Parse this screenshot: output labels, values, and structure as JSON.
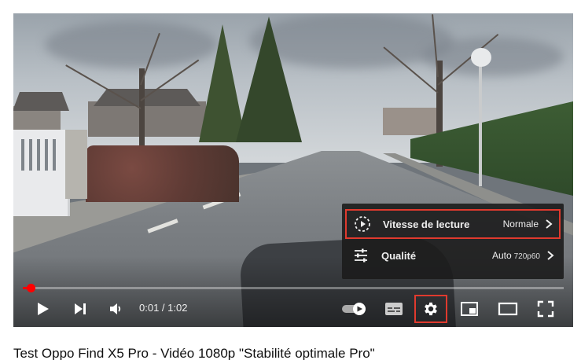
{
  "player": {
    "settings_menu": {
      "items": [
        {
          "label": "Vitesse de lecture",
          "value": "Normale",
          "value_sub": "",
          "icon": "playback-speed-icon"
        },
        {
          "label": "Qualité",
          "value": "Auto",
          "value_sub": "720p60",
          "icon": "quality-sliders-icon"
        }
      ]
    },
    "progress": {
      "fraction": 0.016
    },
    "time": {
      "current": "0:01",
      "separator": " / ",
      "duration": "1:02"
    },
    "icons": [
      "play-icon",
      "next-icon",
      "volume-icon",
      "autoplay-toggle-icon",
      "subtitles-icon",
      "settings-gear-icon",
      "miniplayer-icon",
      "theater-mode-icon",
      "fullscreen-icon"
    ],
    "colors": {
      "progress": "#ff0000",
      "highlight": "#e03a2e",
      "menu_bg": "#1c1c1c"
    }
  },
  "video": {
    "title": "Test Oppo Find X5 Pro - Vidéo 1080p \"Stabilité optimale Pro\""
  }
}
